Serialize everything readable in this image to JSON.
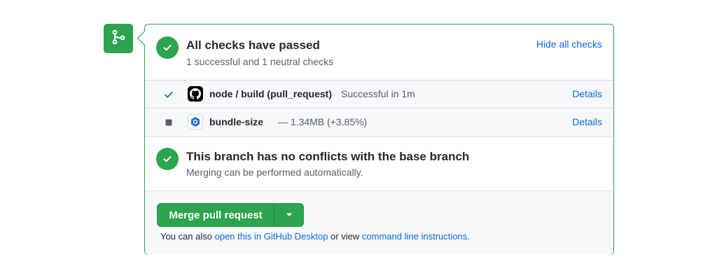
{
  "colors": {
    "success": "#2da44e",
    "link": "#0969da",
    "muted": "#57606a"
  },
  "merge_badge": {
    "icon": "git-merge-icon"
  },
  "checks_summary": {
    "title": "All checks have passed",
    "subtitle": "1 successful and 1 neutral checks",
    "toggle_label": "Hide all checks",
    "icon": "check-circle-icon"
  },
  "checks": [
    {
      "name": "node / build (pull_request)",
      "description": "Successful in 1m",
      "status": "success",
      "status_icon": "check-icon",
      "avatar_icon": "github-logo-icon",
      "details_label": "Details"
    },
    {
      "name": "bundle-size",
      "description": "— 1.34MB (+3.85%)",
      "status": "neutral",
      "status_icon": "square-icon",
      "avatar_icon": "hexagon-app-icon",
      "details_label": "Details"
    }
  ],
  "conflicts": {
    "title": "This branch has no conflicts with the base branch",
    "subtitle": "Merging can be performed automatically.",
    "icon": "check-circle-icon"
  },
  "merge": {
    "button_label": "Merge pull request",
    "caret_icon": "triangle-down-icon",
    "note_prefix": "You can also",
    "desktop_link": "open this in GitHub Desktop",
    "note_middle": "or view",
    "cli_link": "command line instructions",
    "note_suffix": "."
  }
}
